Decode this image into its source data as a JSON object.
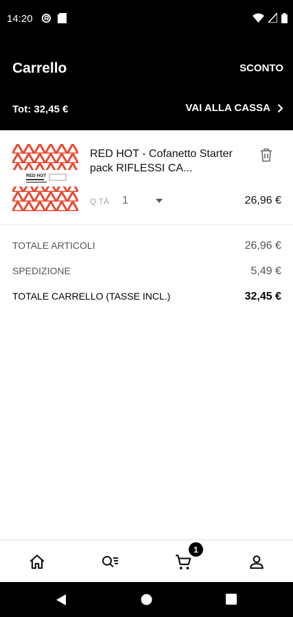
{
  "status_bar": {
    "time": "14:20"
  },
  "header": {
    "title": "Carrello",
    "discount_label": "SCONTO",
    "total_label": "Tot: 32,45 €",
    "checkout_label": "VAI ALLA CASSA"
  },
  "cart_item": {
    "name": "RED HOT - Cofanetto Starter pack RIFLESSI CA...",
    "qty_label": "Q.TÀ",
    "qty_value": "1",
    "price": "26,96 €",
    "thumb_text": "RED HOT"
  },
  "summary": [
    {
      "label": "TOTALE ARTICOLI",
      "value": "26,96 €"
    },
    {
      "label": "SPEDIZIONE",
      "value": "5,49 €"
    },
    {
      "label": "TOTALE CARRELLO (TASSE INCL.)",
      "value": "32,45 €"
    }
  ],
  "bottom_nav": {
    "items": [
      "home-icon",
      "search-list-icon",
      "cart-icon",
      "account-icon"
    ],
    "cart_badge": "1"
  },
  "colors": {
    "header_bg": "#000000",
    "accent": "#000000",
    "thumb_red": "#e8472f"
  }
}
